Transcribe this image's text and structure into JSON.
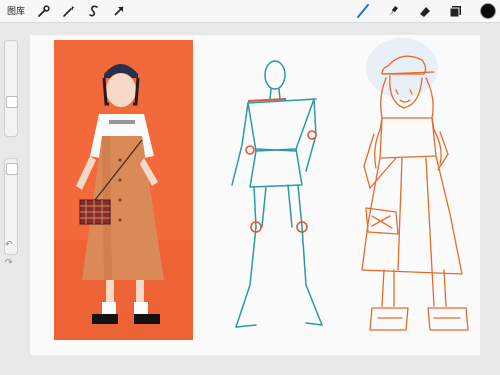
{
  "toolbar": {
    "gallery_label": "图库",
    "left_tools": [
      "wrench-icon",
      "magic-wand-icon",
      "selection-icon",
      "transform-arrow-icon"
    ],
    "right_tools": [
      "brush-icon",
      "smudge-icon",
      "eraser-icon",
      "layers-icon"
    ],
    "active_tool": "brush-icon",
    "active_color": "#0a0a0a"
  },
  "sidebar": {
    "undo_icon": "↶",
    "redo_icon": "↷"
  },
  "canvas": {
    "photo_background": "#f26a3b",
    "gesture_stroke_color": "#2a9aa3",
    "joint_color": "#e2563a",
    "sketch_stroke_color": "#e66a2c"
  }
}
